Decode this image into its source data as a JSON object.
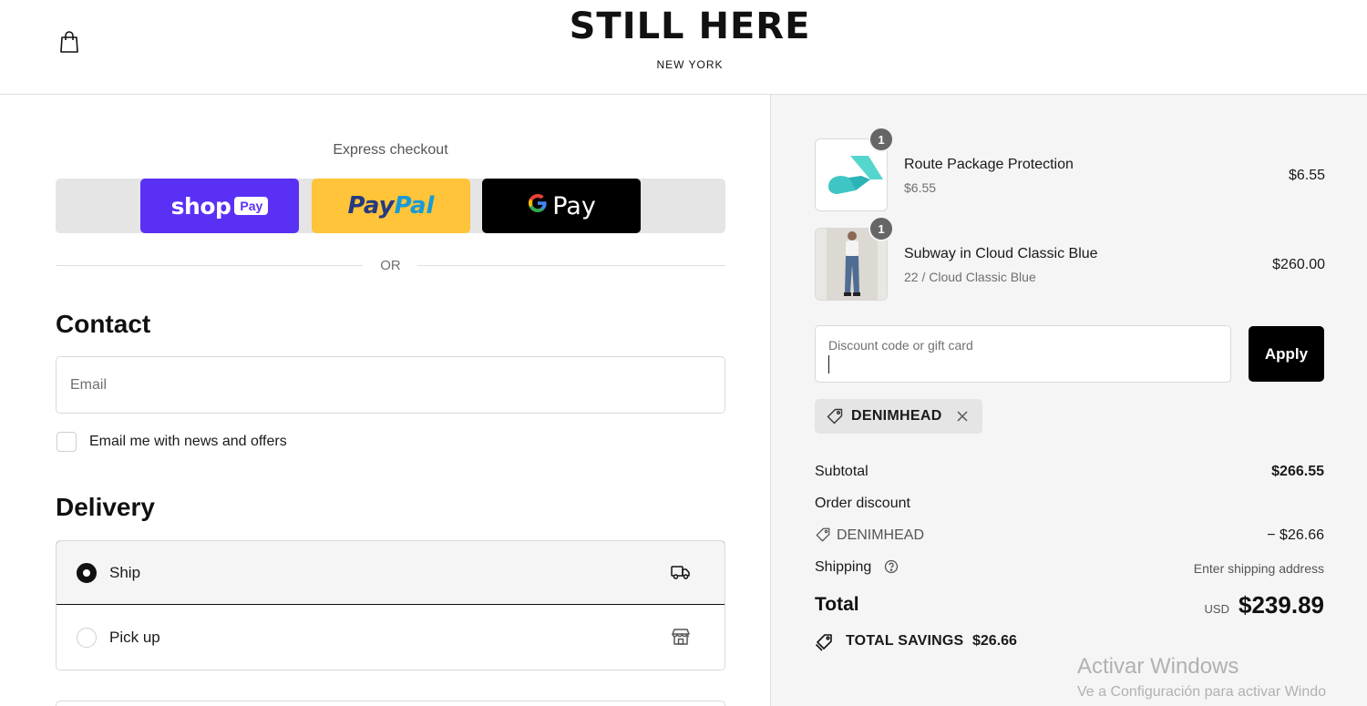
{
  "header": {
    "brand": "STILL HERE",
    "brand_sub": "NEW YORK",
    "cart_icon": "shopping-bag-icon"
  },
  "express": {
    "label": "Express checkout",
    "shop_pay": {
      "word": "shop",
      "badge": "Pay"
    },
    "paypal": {
      "part1": "Pay",
      "part2": "Pal"
    },
    "google_pay": {
      "g": "G",
      "word": "Pay"
    },
    "or": "OR"
  },
  "contact": {
    "title": "Contact",
    "email_placeholder": "Email",
    "email_value": "",
    "newsletter_label": "Email me with news and offers",
    "newsletter_checked": false
  },
  "delivery": {
    "title": "Delivery",
    "options": [
      {
        "label": "Ship",
        "selected": true,
        "icon": "truck-icon"
      },
      {
        "label": "Pick up",
        "selected": false,
        "icon": "store-icon"
      }
    ]
  },
  "summary": {
    "items": [
      {
        "name": "Route Package Protection",
        "sub": "$6.55",
        "price": "$6.55",
        "qty": "1"
      },
      {
        "name": "Subway in Cloud Classic Blue",
        "sub": "22 / Cloud Classic Blue",
        "price": "$260.00",
        "qty": "1"
      }
    ],
    "discount_placeholder": "Discount code or gift card",
    "apply_label": "Apply",
    "applied_code": "DENIMHEAD",
    "subtotal_label": "Subtotal",
    "subtotal_value": "$266.55",
    "order_discount_label": "Order discount",
    "discount_code_label": "DENIMHEAD",
    "discount_value": "− $26.66",
    "shipping_label": "Shipping",
    "shipping_value": "Enter shipping address",
    "total_label": "Total",
    "total_currency": "USD",
    "total_value": "$239.89",
    "savings_label": "TOTAL SAVINGS",
    "savings_value": "$26.66"
  },
  "watermark": {
    "title": "Activar Windows",
    "sub": "Ve a Configuración para activar Windo"
  },
  "colors": {
    "shop_pay": "#5a31f4",
    "paypal": "#ffc439",
    "google_pay": "#000000",
    "summary_bg": "#f5f5f5"
  }
}
